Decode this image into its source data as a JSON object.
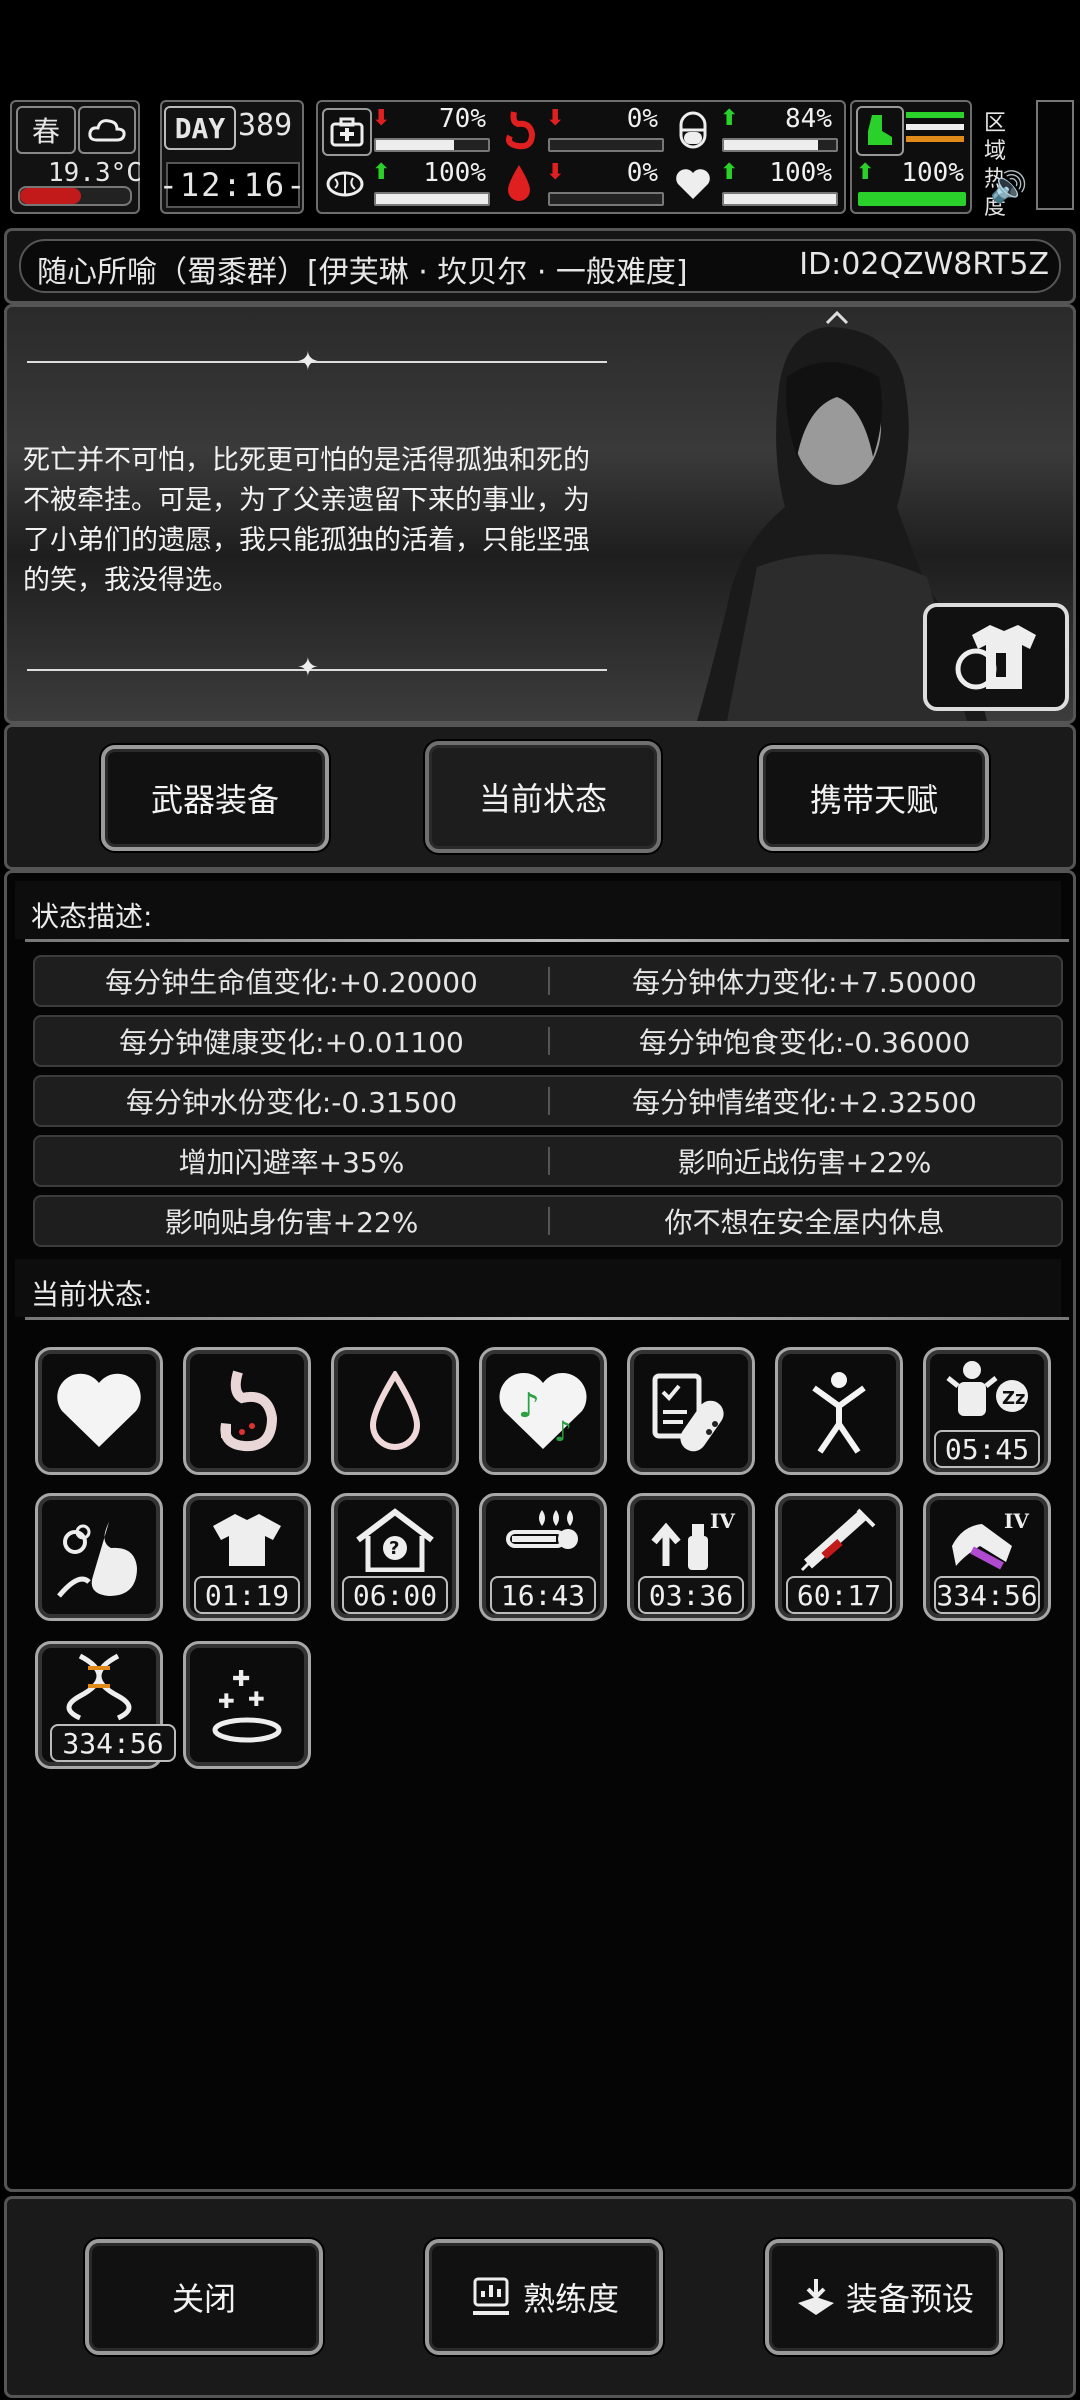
{
  "hud": {
    "season": "春",
    "temperature": "19.3°C",
    "day_label": "DAY",
    "day_value": "389",
    "clock": "-12:16-",
    "stats": [
      {
        "name": "health",
        "value": "70%",
        "trend": "down",
        "fill": 0.7
      },
      {
        "name": "hunger",
        "value": "0%",
        "trend": "down",
        "fill": 0.0
      },
      {
        "name": "sanity",
        "value": "84%",
        "trend": "up",
        "fill": 0.84
      },
      {
        "name": "brain",
        "value": "100%",
        "trend": "up",
        "fill": 1.0
      },
      {
        "name": "thirst",
        "value": "0%",
        "trend": "down",
        "fill": 0.0
      },
      {
        "name": "heart",
        "value": "100%",
        "trend": "up",
        "fill": 1.0
      },
      {
        "name": "stamina",
        "value": "100%",
        "trend": "up",
        "fill": 1.0
      }
    ],
    "zone_heat_label": "区域热度"
  },
  "header": {
    "title": "随心所喻（蜀黍群）[伊芙琳 · 坎贝尔 · 一般难度]",
    "id": "ID:02QZW8RT5Z"
  },
  "portrait": {
    "quote": "死亡并不可怕，比死更可怕的是活得孤独和死的不被牵挂。可是，为了父亲遗留下来的事业，为了小弟们的遗愿，我只能孤独的活着，只能坚强的笑，我没得选。"
  },
  "tabs": [
    "武器装备",
    "当前状态",
    "携带天赋"
  ],
  "status_desc": {
    "title": "状态描述:",
    "rows": [
      [
        "每分钟生命值变化:+0.20000",
        "每分钟体力变化:+7.50000"
      ],
      [
        "每分钟健康变化:+0.01100",
        "每分钟饱食变化:-0.36000"
      ],
      [
        "每分钟水份变化:-0.31500",
        "每分钟情绪变化:+2.32500"
      ],
      [
        "增加闪避率+35%",
        "影响近战伤害+22%"
      ],
      [
        "影响贴身伤害+22%",
        "你不想在安全屋内休息"
      ]
    ]
  },
  "current_status": {
    "title": "当前状态:",
    "icons": [
      {
        "icon": "heart-icon",
        "timer": ""
      },
      {
        "icon": "stomach-icon",
        "timer": ""
      },
      {
        "icon": "water-drop-icon",
        "timer": ""
      },
      {
        "icon": "music-heart-icon",
        "timer": ""
      },
      {
        "icon": "medicine-icon",
        "timer": ""
      },
      {
        "icon": "person-stretch-icon",
        "timer": ""
      },
      {
        "icon": "sleep-icon",
        "timer": "05:45"
      },
      {
        "icon": "sick-stomach-icon",
        "timer": ""
      },
      {
        "icon": "clothes-icon",
        "timer": "01:19"
      },
      {
        "icon": "shelter-icon",
        "timer": "06:00"
      },
      {
        "icon": "hot-thermometer-icon",
        "timer": "16:43"
      },
      {
        "icon": "iv-boost-icon",
        "timer": "03:36"
      },
      {
        "icon": "syringe-icon",
        "timer": "60:17"
      },
      {
        "icon": "iv-arm-icon",
        "timer": "334:56"
      },
      {
        "icon": "dna-icon",
        "timer": "334:56"
      },
      {
        "icon": "sparkle-ring-icon",
        "timer": ""
      }
    ]
  },
  "footer": {
    "close": "关闭",
    "proficiency": "熟练度",
    "preset": "装备预设"
  }
}
